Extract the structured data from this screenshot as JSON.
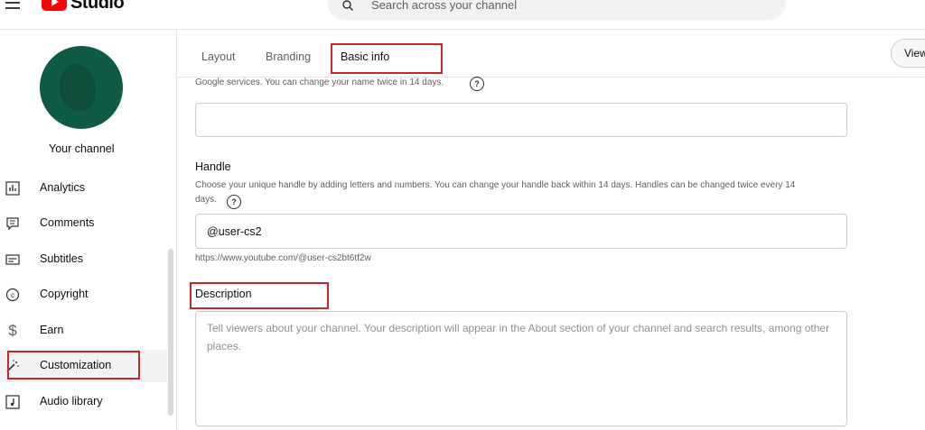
{
  "header": {
    "logo_text": "Studio",
    "search_placeholder": "Search across your channel"
  },
  "sidebar": {
    "channel_label": "Your channel",
    "items": [
      {
        "label": "Analytics",
        "icon": "bar-chart-icon"
      },
      {
        "label": "Comments",
        "icon": "comment-icon"
      },
      {
        "label": "Subtitles",
        "icon": "subtitles-icon"
      },
      {
        "label": "Copyright",
        "icon": "copyright-icon"
      },
      {
        "label": "Earn",
        "icon": "dollar-icon"
      },
      {
        "label": "Customization",
        "icon": "magic-wand-icon",
        "active": true
      },
      {
        "label": "Audio library",
        "icon": "audio-library-icon"
      }
    ]
  },
  "tabs": [
    {
      "label": "Layout"
    },
    {
      "label": "Branding"
    },
    {
      "label": "Basic info",
      "active": true
    }
  ],
  "view_button": "View",
  "name_section": {
    "help_text": "Google services. You can change your name twice in 14 days."
  },
  "handle_section": {
    "title": "Handle",
    "help_text_line1": "Choose your unique handle by adding letters and numbers. You can change your handle back within 14 days. Handles can be changed twice every 14",
    "help_text_line2": "days.",
    "value": "@user-cs2",
    "url": "https://www.youtube.com/@user-cs2bt6tf2w"
  },
  "description_section": {
    "title": "Description",
    "placeholder": "Tell viewers about your channel. Your description will appear in the About section of your channel and search results, among other places."
  },
  "colors": {
    "brand_red": "#ff0000",
    "highlight_red": "#c62828",
    "avatar_green": "#0f5b45"
  }
}
